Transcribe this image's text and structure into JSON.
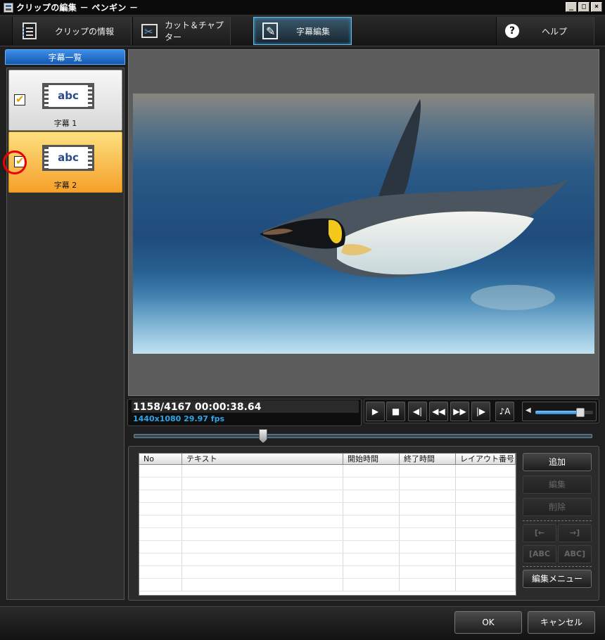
{
  "window": {
    "title": "クリップの編集 － ペンギン －",
    "buttons": [
      "_",
      "□",
      "×"
    ]
  },
  "tabs": [
    {
      "label": "クリップの情報",
      "icon": "clip-info-icon",
      "active": false
    },
    {
      "label": "カット＆チャプター",
      "icon": "cut-chapter-icon",
      "active": false
    },
    {
      "label": "字幕編集",
      "icon": "subtitle-edit-icon",
      "active": true
    },
    {
      "label": "ヘルプ",
      "icon": "help-icon",
      "active": false
    }
  ],
  "subtitle_list": {
    "header": "字幕一覧",
    "items": [
      {
        "label": "字幕 1",
        "thumb_text": "abc",
        "checked": true,
        "selected": false
      },
      {
        "label": "字幕 2",
        "thumb_text": "abc",
        "checked": true,
        "selected": true
      }
    ]
  },
  "player": {
    "frame_time": "1158/4167  00:00:38.64",
    "format": "1440x1080 29.97 fps",
    "seek_fraction": 0.28,
    "volume_fraction": 0.78,
    "controls": [
      "play-icon",
      "stop-icon",
      "step-back-icon",
      "rewind-icon",
      "fast-forward-icon",
      "step-forward-icon",
      "audio-track-icon"
    ]
  },
  "table": {
    "columns": [
      "No",
      "テキスト",
      "開始時間",
      "終了時間",
      "レイアウト番号"
    ],
    "row_count": 10
  },
  "side_buttons": {
    "add": "追加",
    "edit": "編集",
    "delete": "削除",
    "move_left": "[←",
    "move_right": "→]",
    "abc_left": "[ABC",
    "abc_right": "ABC]",
    "edit_menu": "編集メニュー"
  },
  "footer": {
    "ok": "OK",
    "cancel": "キャンセル"
  },
  "colors": {
    "accent": "#3c9fd8",
    "selected_item": "#f6a02a",
    "timecode_sub": "#2aa6ea",
    "annotation": "#e00000"
  }
}
